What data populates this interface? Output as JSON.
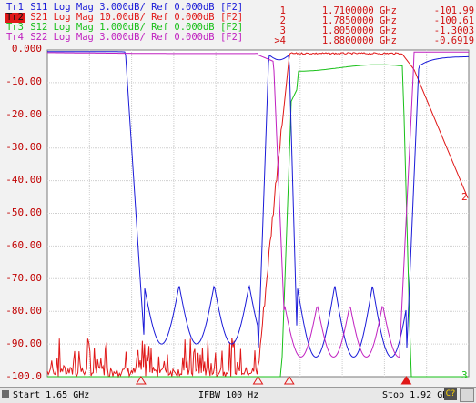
{
  "traces": [
    {
      "tag": "Tr1",
      "param": "S11",
      "format": "Log Mag",
      "scale": "3.000dB/",
      "ref": "Ref 0.000dB",
      "port": "[F2]",
      "color": "#1a1ad8",
      "active": false
    },
    {
      "tag": "Tr2",
      "param": "S21",
      "format": "Log Mag",
      "scale": "10.00dB/",
      "ref": "Ref 0.000dB",
      "port": "[F2]",
      "color": "#e01818",
      "active": true
    },
    {
      "tag": "Tr3",
      "param": "S12",
      "format": "Log Mag",
      "scale": "1.000dB/",
      "ref": "Ref 0.000dB",
      "port": "[F2]",
      "color": "#18c018",
      "active": false
    },
    {
      "tag": "Tr4",
      "param": "S22",
      "format": "Log Mag",
      "scale": "3.000dB/",
      "ref": "Ref 0.000dB",
      "port": "[F2]",
      "color": "#c020c0",
      "active": false
    }
  ],
  "markers": [
    {
      "id": "1",
      "freq": "1.7100000 GHz",
      "value": "-101.99 dB",
      "active": false
    },
    {
      "id": "2",
      "freq": "1.7850000 GHz",
      "value": "-100.61 dB",
      "active": false
    },
    {
      "id": "3",
      "freq": "1.8050000 GHz",
      "value": "-1.3003 dB",
      "active": false
    },
    {
      "id": "4",
      "freq": "1.8800000 GHz",
      "value": "-0.6919 dB",
      "active": true,
      "prefix": ">"
    }
  ],
  "yaxis": {
    "labels": [
      "0.000",
      "-10.00",
      "-20.00",
      "-30.00",
      "-40.00",
      "-50.00",
      "-60.00",
      "-70.00",
      "-80.00",
      "-90.00",
      "-100.0"
    ],
    "top": 0,
    "bottom": -100
  },
  "chart_data": {
    "type": "line",
    "xlim": [
      1.65,
      1.92
    ],
    "ylim": [
      -100,
      0
    ],
    "series": [
      {
        "name": "S21",
        "values_db": "filter passband 1.805-1.880 GHz",
        "trace": "Tr2"
      },
      {
        "name": "S12",
        "trace": "Tr3"
      },
      {
        "name": "S11",
        "trace": "Tr1"
      },
      {
        "name": "S22",
        "trace": "Tr4"
      }
    ]
  },
  "trace_end_labels": {
    "tr2": "2",
    "tr3": "3"
  },
  "status": {
    "start": "Start 1.65 GHz",
    "ifbw": "IFBW 100 Hz",
    "stop": "Stop 1.92 GHz",
    "badge": "C?"
  }
}
